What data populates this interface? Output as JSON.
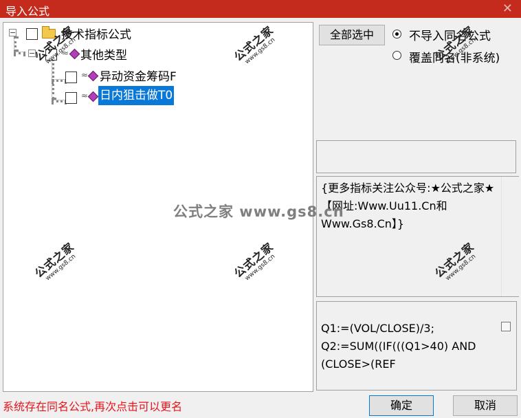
{
  "window": {
    "title": "导入公式",
    "close_glyph": "✕"
  },
  "tree": {
    "root": {
      "label": "技术指标公式",
      "expander": "−"
    },
    "group": {
      "label": "其他类型",
      "expander": "−"
    },
    "items": [
      {
        "label": "异动资金筹码F",
        "selected": false
      },
      {
        "label": "日内狙击做T0",
        "selected": true
      }
    ],
    "icon_colors": {
      "folder": "#f2c94c",
      "formula_diamond": "#b33fb8"
    }
  },
  "controls": {
    "select_all_label": "全部选中",
    "radio_options": [
      {
        "label": "不导入同名公式",
        "checked": true
      },
      {
        "label": "覆盖同名(非系统)",
        "checked": false
      }
    ]
  },
  "description": {
    "text": "{更多指标关注公众号:★公式之家★【网址:Www.Uu11.Cn和Www.Gs8.Cn】}"
  },
  "code_preview": {
    "text": "Q1:=(VOL/CLOSE)/3;\nQ2:=SUM((IF(((Q1>40) AND (CLOSE>(REF"
  },
  "status": {
    "message": "系统存在同名公式,再次点击可以更名",
    "color": "#e8141a"
  },
  "buttons": {
    "ok_label": "确定",
    "cancel_label": "取消"
  },
  "watermark": {
    "main": "公式之家",
    "url": "www.gs8.cn",
    "center": "公式之家 www.gs8.cn"
  },
  "colors": {
    "titlebar": "#c42b1c",
    "selection": "#0a78d7"
  }
}
